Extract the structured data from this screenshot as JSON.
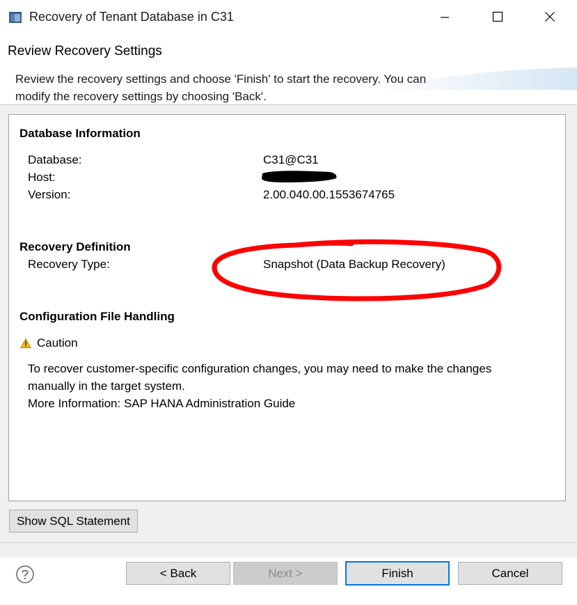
{
  "window": {
    "title": "Recovery of Tenant Database in C31",
    "icon": "app-window-icon"
  },
  "header": {
    "heading": "Review Recovery Settings",
    "description": "Review the recovery settings and choose 'Finish' to start the recovery. You can modify the recovery settings by choosing 'Back'."
  },
  "sections": {
    "database_info": {
      "title": "Database Information",
      "database_label": "Database:",
      "database_value": "C31@C31",
      "host_label": "Host:",
      "version_label": "Version:",
      "version_value": "2.00.040.00.1553674765"
    },
    "recovery_definition": {
      "title": "Recovery Definition",
      "type_label": "Recovery Type:",
      "type_value": "Snapshot (Data Backup Recovery)"
    },
    "config_handling": {
      "title": "Configuration File Handling",
      "caution_label": "Caution",
      "message_line1": "To recover customer-specific configuration changes, you may need to make the changes",
      "message_line2": "manually in the target system.",
      "more_info": "More Information: SAP HANA Administration Guide"
    }
  },
  "buttons": {
    "show_sql": "Show SQL Statement",
    "back": "< Back",
    "next": "Next >",
    "finish": "Finish",
    "cancel": "Cancel"
  },
  "colors": {
    "annotation": "#ff0000",
    "accent": "#0078d7",
    "warning": "#f5c211"
  }
}
